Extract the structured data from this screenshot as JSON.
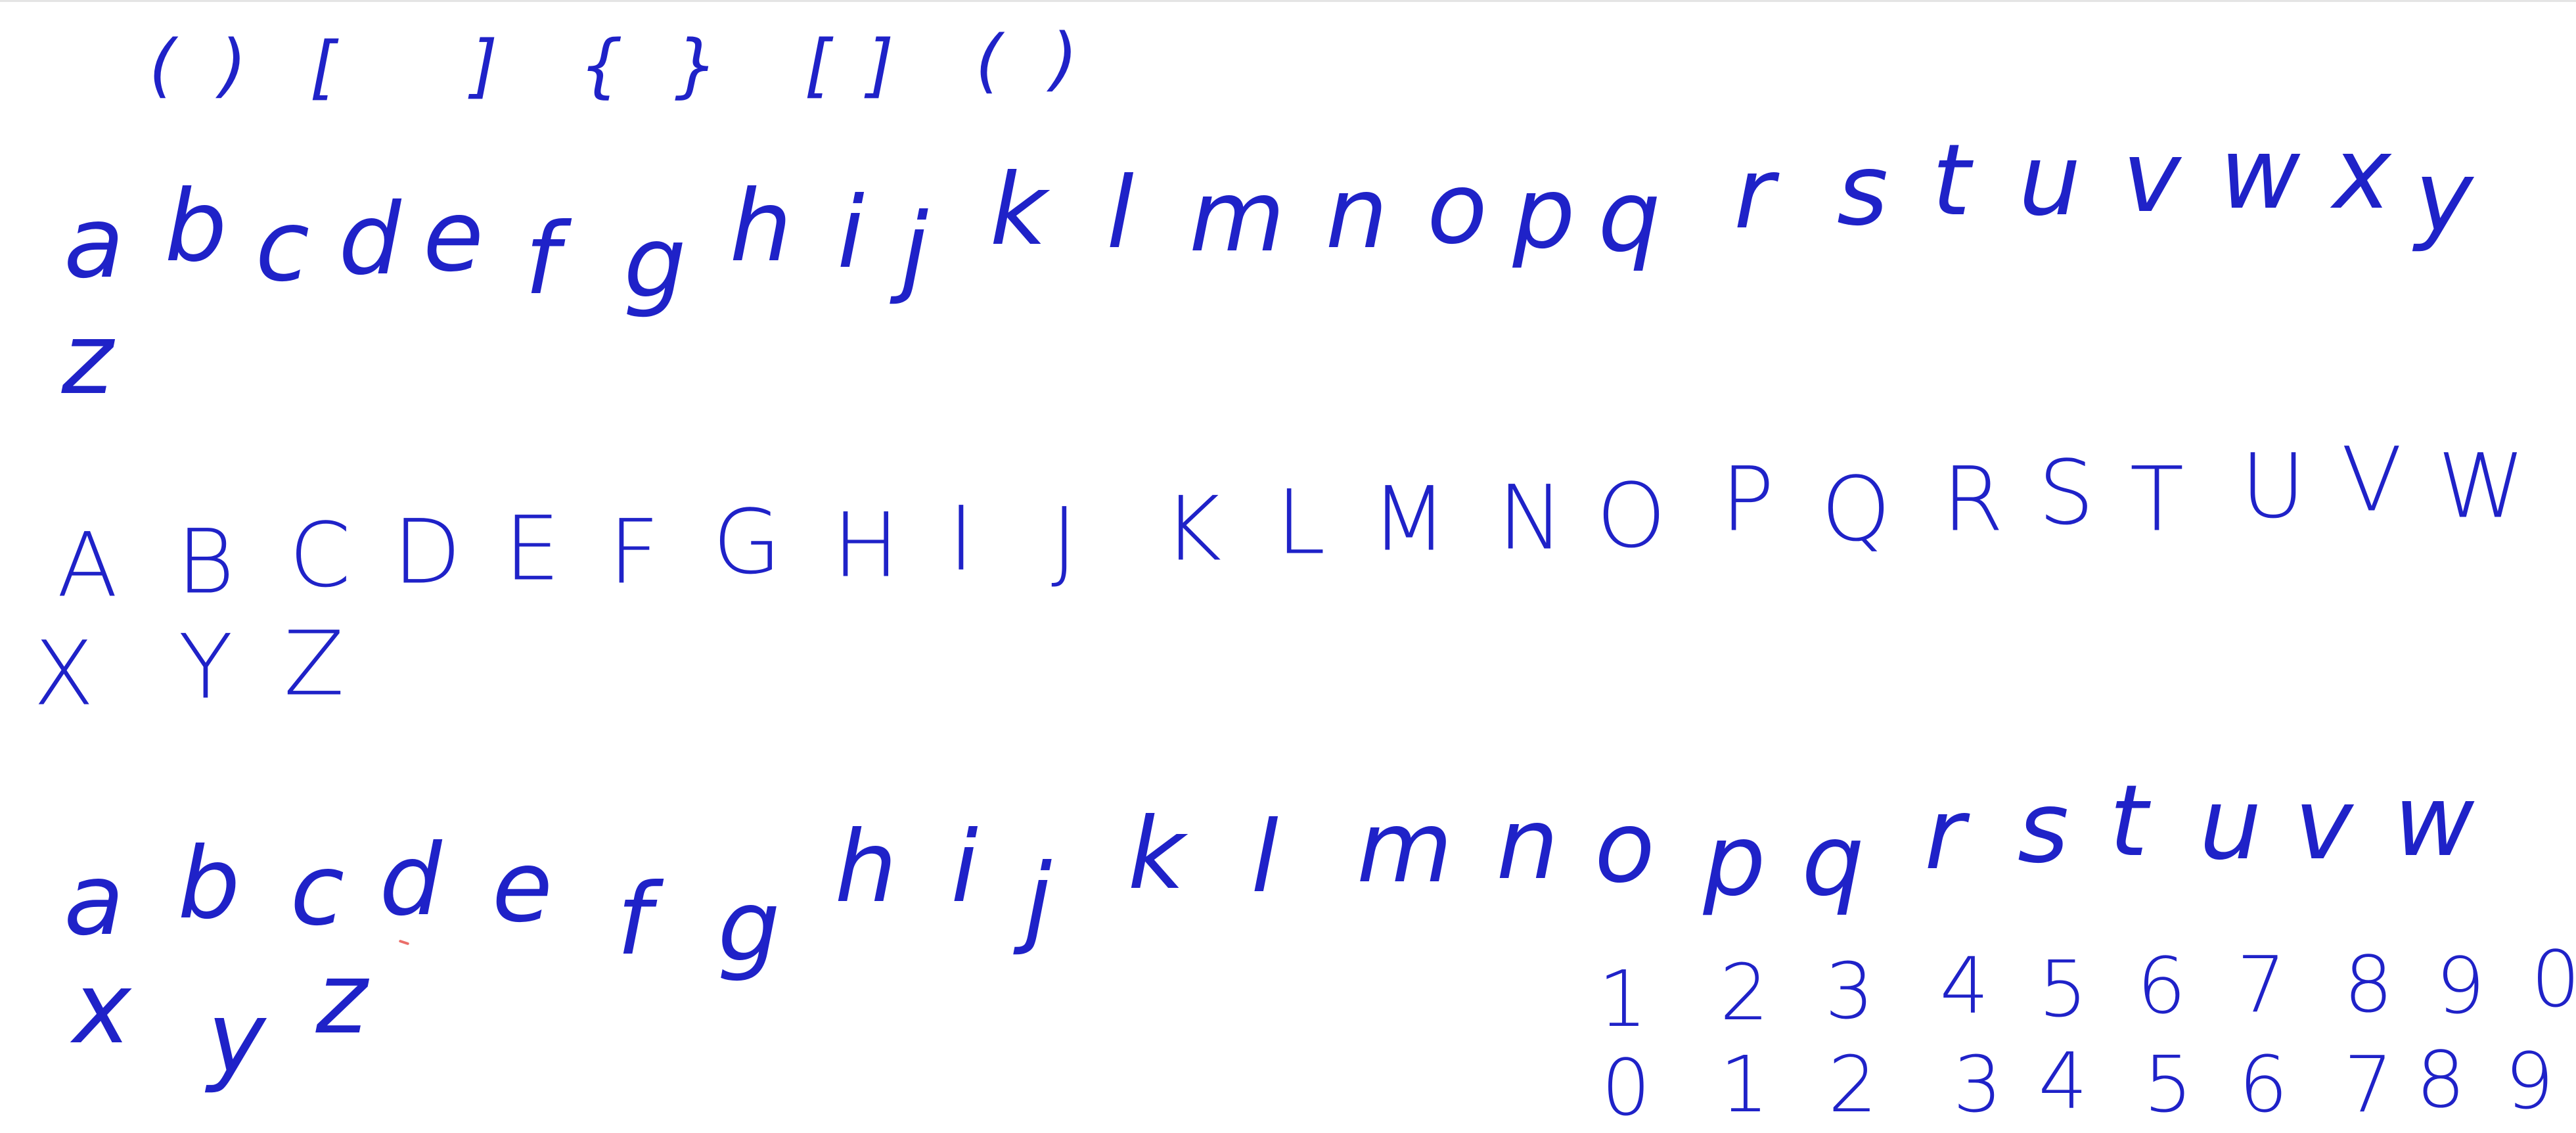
{
  "page": {
    "ink_color": "#1f22c8",
    "paper_color": "#ffffff"
  },
  "rows": [
    {
      "id": "brackets",
      "style": "bracket",
      "glyphs": [
        "(",
        ")",
        "[",
        "]",
        "{",
        "}",
        "[",
        "]",
        "(",
        ")"
      ]
    },
    {
      "id": "lowercase-1",
      "style": "lower",
      "glyphs": [
        "a",
        "b",
        "c",
        "d",
        "e",
        "f",
        "g",
        "h",
        "i",
        "j",
        "k",
        "l",
        "m",
        "n",
        "o",
        "p",
        "q",
        "r",
        "s",
        "t",
        "u",
        "v",
        "w",
        "x",
        "y",
        "z"
      ]
    },
    {
      "id": "uppercase",
      "style": "upper",
      "glyphs": [
        "A",
        "B",
        "C",
        "D",
        "E",
        "F",
        "G",
        "H",
        "I",
        "J",
        "K",
        "L",
        "M",
        "N",
        "O",
        "P",
        "Q",
        "R",
        "S",
        "T",
        "U",
        "V",
        "W",
        "X",
        "Y",
        "Z"
      ]
    },
    {
      "id": "lowercase-2",
      "style": "lower",
      "glyphs": [
        "a",
        "b",
        "c",
        "d",
        "e",
        "f",
        "g",
        "h",
        "i",
        "j",
        "k",
        "l",
        "m",
        "n",
        "o",
        "p",
        "q",
        "r",
        "s",
        "t",
        "u",
        "v",
        "w",
        "x",
        "y",
        "z"
      ]
    },
    {
      "id": "digits-1",
      "style": "digit",
      "glyphs": [
        "1",
        "2",
        "3",
        "4",
        "5",
        "6",
        "7",
        "8",
        "9",
        "0"
      ]
    },
    {
      "id": "digits-2",
      "style": "digit",
      "glyphs": [
        "0",
        "1",
        "2",
        "3",
        "4",
        "5",
        "6",
        "7",
        "8",
        "9"
      ]
    }
  ]
}
